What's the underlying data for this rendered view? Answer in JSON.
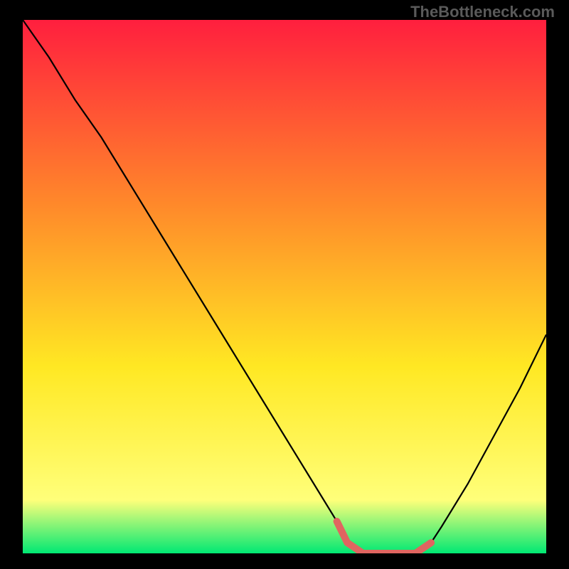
{
  "watermark": "TheBottleneck.com",
  "chart_data": {
    "type": "line",
    "title": "",
    "xlabel": "",
    "ylabel": "",
    "xlim": [
      0,
      100
    ],
    "ylim": [
      0,
      100
    ],
    "grid": false,
    "background_gradient": {
      "top": "#ff1f3e",
      "mid1": "#ff8a2a",
      "mid2": "#ffe823",
      "mid3": "#ffff7a",
      "bottom": "#00e873"
    },
    "series": [
      {
        "name": "main-curve",
        "color": "#000000",
        "x": [
          0,
          5,
          10,
          15,
          20,
          25,
          30,
          35,
          40,
          45,
          50,
          55,
          60,
          62,
          65,
          70,
          75,
          78,
          80,
          85,
          90,
          95,
          100
        ],
        "y_pct": [
          100,
          93,
          85,
          78,
          70,
          62,
          54,
          46,
          38,
          30,
          22,
          14,
          6,
          2,
          0,
          0,
          0,
          2,
          5,
          13,
          22,
          31,
          41
        ]
      },
      {
        "name": "highlight-segment",
        "color": "#e06560",
        "thick": true,
        "x": [
          60,
          62,
          65,
          70,
          75,
          78
        ],
        "y_pct": [
          6,
          2,
          0,
          0,
          0,
          2
        ]
      }
    ]
  }
}
